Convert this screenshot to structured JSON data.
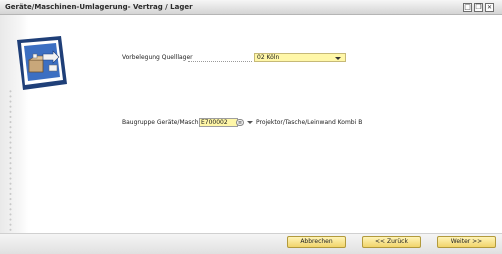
{
  "window": {
    "title": "Geräte/Maschinen-Umlagerung- Vertrag / Lager",
    "controls": {
      "maximize": "□",
      "restore": "❐",
      "close": "✕"
    }
  },
  "form": {
    "source_label": "Vorbelegung Quelllager",
    "source_value": "02 Köln",
    "group_label": "Baugruppe Geräte/Masch",
    "group_value": "E700002",
    "lookup_symbol": "≡",
    "group_description": "Projektor/Tasche/Leinwand Kombi B"
  },
  "buttons": {
    "cancel": "Abbrechen",
    "back": "<< Zurück",
    "next": "Weiter >>"
  },
  "icons": {
    "logo": "wizard-box-arrow-icon",
    "dropdown": "chevron-down-icon"
  },
  "colors": {
    "field_yellow": "#fff7a8",
    "button_yellow": "#f1d46a",
    "logo_blue": "#2a5aa8"
  }
}
